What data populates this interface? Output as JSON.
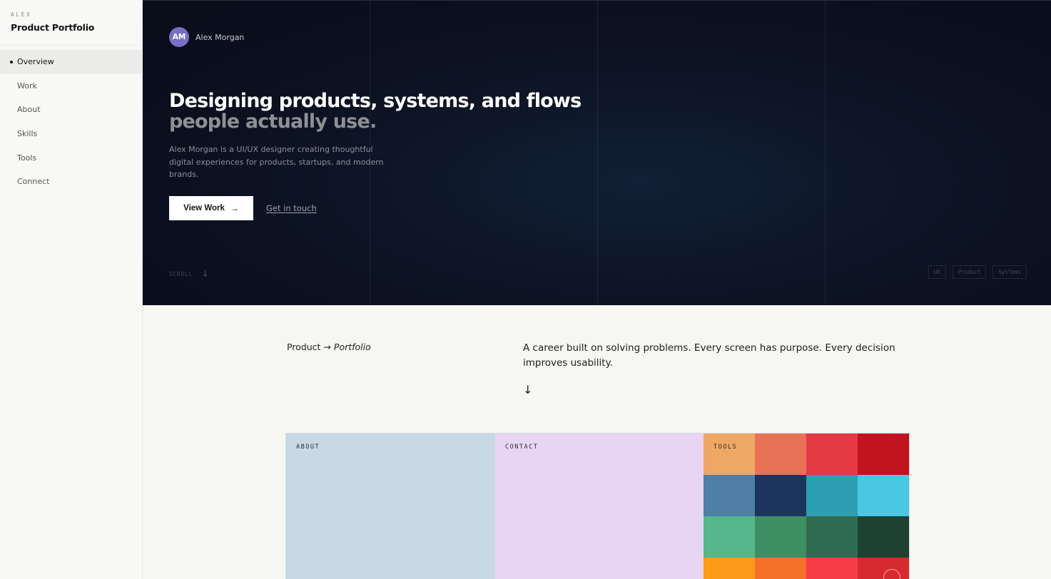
{
  "sidebar": {
    "kicker": "ALEX",
    "title": "Product Portfolio",
    "items": [
      {
        "label": "Overview",
        "active": true
      },
      {
        "label": "Work"
      },
      {
        "label": "About"
      },
      {
        "label": "Skills"
      },
      {
        "label": "Tools"
      },
      {
        "label": "Connect"
      }
    ]
  },
  "hero": {
    "avatar_initials": "AM",
    "avatar_color": "#7a6fc4",
    "name": "Alex Morgan",
    "headline_line1": "Designing products, systems, and flows",
    "headline_line2": "people actually use.",
    "lead": "Alex Morgan is a UI/UX designer creating thoughtful digital experiences for products, startups, and modern brands.",
    "primary_button": "View Work",
    "primary_button_icon": "arrow-right-icon",
    "secondary_link": "Get in touch",
    "scroll_label": "SCROLL",
    "scroll_icon": "arrow-down-icon",
    "tags": [
      "UX",
      "Product",
      "Systems"
    ]
  },
  "intro": {
    "left_prefix": "Product →",
    "left_emphasis": "Portfolio",
    "statement": "A career built on solving problems. Every screen has purpose. Every decision improves usability.",
    "down_icon": "arrow-down-icon"
  },
  "cards": {
    "about": {
      "label": "ABOUT",
      "color": "#c8d8e5"
    },
    "contact": {
      "label": "CONTACT",
      "color": "#e8d5f3"
    },
    "tools": {
      "label": "TOOLS",
      "swatches": [
        "#efa765",
        "#e77256",
        "#e33a44",
        "#c1141f",
        "#4f7fa6",
        "#1d355e",
        "#2e9fb3",
        "#4ac8e3",
        "#55b78b",
        "#3f8f64",
        "#2f6b52",
        "#1d4231",
        "#fb9b19",
        "#f5702b",
        "#f63c45",
        "#d72a2f"
      ]
    }
  }
}
